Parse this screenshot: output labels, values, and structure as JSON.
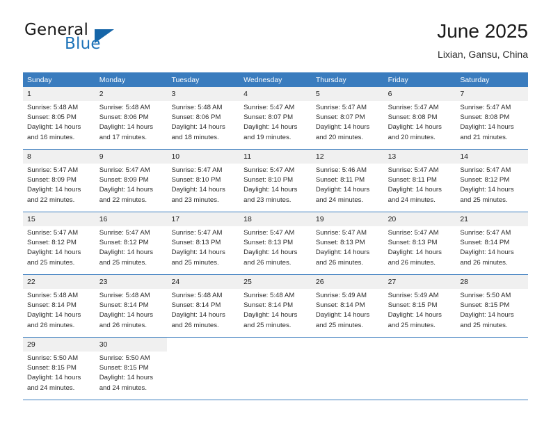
{
  "brand": {
    "name_part1": "General",
    "name_part2": "Blue",
    "logo_icon": "triangle-icon"
  },
  "header": {
    "title": "June 2025",
    "subtitle": "Lixian, Gansu, China"
  },
  "theme": {
    "accent": "#3a7cbe",
    "brand_blue": "#1c72b8",
    "day_header_bg": "#f0f0f0",
    "page_bg": "#ffffff",
    "text": "#2b2b2b"
  },
  "calendar": {
    "weekdays": [
      "Sunday",
      "Monday",
      "Tuesday",
      "Wednesday",
      "Thursday",
      "Friday",
      "Saturday"
    ],
    "labels": {
      "sunrise": "Sunrise:",
      "sunset": "Sunset:",
      "daylight": "Daylight:"
    },
    "weeks": [
      [
        {
          "day": "1",
          "sunrise": "Sunrise: 5:48 AM",
          "sunset": "Sunset: 8:05 PM",
          "daylight_l1": "Daylight: 14 hours",
          "daylight_l2": "and 16 minutes."
        },
        {
          "day": "2",
          "sunrise": "Sunrise: 5:48 AM",
          "sunset": "Sunset: 8:06 PM",
          "daylight_l1": "Daylight: 14 hours",
          "daylight_l2": "and 17 minutes."
        },
        {
          "day": "3",
          "sunrise": "Sunrise: 5:48 AM",
          "sunset": "Sunset: 8:06 PM",
          "daylight_l1": "Daylight: 14 hours",
          "daylight_l2": "and 18 minutes."
        },
        {
          "day": "4",
          "sunrise": "Sunrise: 5:47 AM",
          "sunset": "Sunset: 8:07 PM",
          "daylight_l1": "Daylight: 14 hours",
          "daylight_l2": "and 19 minutes."
        },
        {
          "day": "5",
          "sunrise": "Sunrise: 5:47 AM",
          "sunset": "Sunset: 8:07 PM",
          "daylight_l1": "Daylight: 14 hours",
          "daylight_l2": "and 20 minutes."
        },
        {
          "day": "6",
          "sunrise": "Sunrise: 5:47 AM",
          "sunset": "Sunset: 8:08 PM",
          "daylight_l1": "Daylight: 14 hours",
          "daylight_l2": "and 20 minutes."
        },
        {
          "day": "7",
          "sunrise": "Sunrise: 5:47 AM",
          "sunset": "Sunset: 8:08 PM",
          "daylight_l1": "Daylight: 14 hours",
          "daylight_l2": "and 21 minutes."
        }
      ],
      [
        {
          "day": "8",
          "sunrise": "Sunrise: 5:47 AM",
          "sunset": "Sunset: 8:09 PM",
          "daylight_l1": "Daylight: 14 hours",
          "daylight_l2": "and 22 minutes."
        },
        {
          "day": "9",
          "sunrise": "Sunrise: 5:47 AM",
          "sunset": "Sunset: 8:09 PM",
          "daylight_l1": "Daylight: 14 hours",
          "daylight_l2": "and 22 minutes."
        },
        {
          "day": "10",
          "sunrise": "Sunrise: 5:47 AM",
          "sunset": "Sunset: 8:10 PM",
          "daylight_l1": "Daylight: 14 hours",
          "daylight_l2": "and 23 minutes."
        },
        {
          "day": "11",
          "sunrise": "Sunrise: 5:47 AM",
          "sunset": "Sunset: 8:10 PM",
          "daylight_l1": "Daylight: 14 hours",
          "daylight_l2": "and 23 minutes."
        },
        {
          "day": "12",
          "sunrise": "Sunrise: 5:46 AM",
          "sunset": "Sunset: 8:11 PM",
          "daylight_l1": "Daylight: 14 hours",
          "daylight_l2": "and 24 minutes."
        },
        {
          "day": "13",
          "sunrise": "Sunrise: 5:47 AM",
          "sunset": "Sunset: 8:11 PM",
          "daylight_l1": "Daylight: 14 hours",
          "daylight_l2": "and 24 minutes."
        },
        {
          "day": "14",
          "sunrise": "Sunrise: 5:47 AM",
          "sunset": "Sunset: 8:12 PM",
          "daylight_l1": "Daylight: 14 hours",
          "daylight_l2": "and 25 minutes."
        }
      ],
      [
        {
          "day": "15",
          "sunrise": "Sunrise: 5:47 AM",
          "sunset": "Sunset: 8:12 PM",
          "daylight_l1": "Daylight: 14 hours",
          "daylight_l2": "and 25 minutes."
        },
        {
          "day": "16",
          "sunrise": "Sunrise: 5:47 AM",
          "sunset": "Sunset: 8:12 PM",
          "daylight_l1": "Daylight: 14 hours",
          "daylight_l2": "and 25 minutes."
        },
        {
          "day": "17",
          "sunrise": "Sunrise: 5:47 AM",
          "sunset": "Sunset: 8:13 PM",
          "daylight_l1": "Daylight: 14 hours",
          "daylight_l2": "and 25 minutes."
        },
        {
          "day": "18",
          "sunrise": "Sunrise: 5:47 AM",
          "sunset": "Sunset: 8:13 PM",
          "daylight_l1": "Daylight: 14 hours",
          "daylight_l2": "and 26 minutes."
        },
        {
          "day": "19",
          "sunrise": "Sunrise: 5:47 AM",
          "sunset": "Sunset: 8:13 PM",
          "daylight_l1": "Daylight: 14 hours",
          "daylight_l2": "and 26 minutes."
        },
        {
          "day": "20",
          "sunrise": "Sunrise: 5:47 AM",
          "sunset": "Sunset: 8:13 PM",
          "daylight_l1": "Daylight: 14 hours",
          "daylight_l2": "and 26 minutes."
        },
        {
          "day": "21",
          "sunrise": "Sunrise: 5:47 AM",
          "sunset": "Sunset: 8:14 PM",
          "daylight_l1": "Daylight: 14 hours",
          "daylight_l2": "and 26 minutes."
        }
      ],
      [
        {
          "day": "22",
          "sunrise": "Sunrise: 5:48 AM",
          "sunset": "Sunset: 8:14 PM",
          "daylight_l1": "Daylight: 14 hours",
          "daylight_l2": "and 26 minutes."
        },
        {
          "day": "23",
          "sunrise": "Sunrise: 5:48 AM",
          "sunset": "Sunset: 8:14 PM",
          "daylight_l1": "Daylight: 14 hours",
          "daylight_l2": "and 26 minutes."
        },
        {
          "day": "24",
          "sunrise": "Sunrise: 5:48 AM",
          "sunset": "Sunset: 8:14 PM",
          "daylight_l1": "Daylight: 14 hours",
          "daylight_l2": "and 26 minutes."
        },
        {
          "day": "25",
          "sunrise": "Sunrise: 5:48 AM",
          "sunset": "Sunset: 8:14 PM",
          "daylight_l1": "Daylight: 14 hours",
          "daylight_l2": "and 25 minutes."
        },
        {
          "day": "26",
          "sunrise": "Sunrise: 5:49 AM",
          "sunset": "Sunset: 8:14 PM",
          "daylight_l1": "Daylight: 14 hours",
          "daylight_l2": "and 25 minutes."
        },
        {
          "day": "27",
          "sunrise": "Sunrise: 5:49 AM",
          "sunset": "Sunset: 8:15 PM",
          "daylight_l1": "Daylight: 14 hours",
          "daylight_l2": "and 25 minutes."
        },
        {
          "day": "28",
          "sunrise": "Sunrise: 5:50 AM",
          "sunset": "Sunset: 8:15 PM",
          "daylight_l1": "Daylight: 14 hours",
          "daylight_l2": "and 25 minutes."
        }
      ],
      [
        {
          "day": "29",
          "sunrise": "Sunrise: 5:50 AM",
          "sunset": "Sunset: 8:15 PM",
          "daylight_l1": "Daylight: 14 hours",
          "daylight_l2": "and 24 minutes."
        },
        {
          "day": "30",
          "sunrise": "Sunrise: 5:50 AM",
          "sunset": "Sunset: 8:15 PM",
          "daylight_l1": "Daylight: 14 hours",
          "daylight_l2": "and 24 minutes."
        },
        {
          "day": "",
          "sunrise": "",
          "sunset": "",
          "daylight_l1": "",
          "daylight_l2": ""
        },
        {
          "day": "",
          "sunrise": "",
          "sunset": "",
          "daylight_l1": "",
          "daylight_l2": ""
        },
        {
          "day": "",
          "sunrise": "",
          "sunset": "",
          "daylight_l1": "",
          "daylight_l2": ""
        },
        {
          "day": "",
          "sunrise": "",
          "sunset": "",
          "daylight_l1": "",
          "daylight_l2": ""
        },
        {
          "day": "",
          "sunrise": "",
          "sunset": "",
          "daylight_l1": "",
          "daylight_l2": ""
        }
      ]
    ]
  }
}
